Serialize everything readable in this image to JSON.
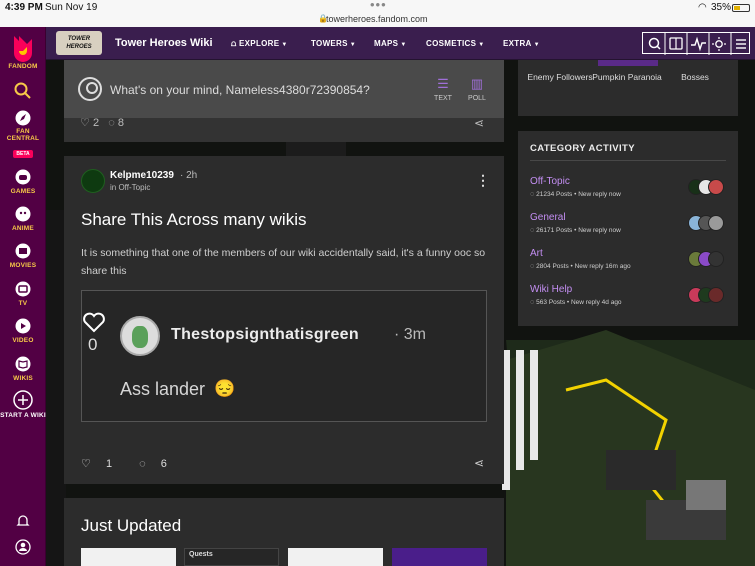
{
  "status_bar": {
    "time": "4:39 PM",
    "date": "Sun Nov 19",
    "url": "towerheroes.fandom.com",
    "battery": "35%"
  },
  "rail": {
    "items": [
      {
        "label": "FANDOM",
        "icon": "fandom-logo-icon"
      },
      {
        "label": "",
        "icon": "search-icon"
      },
      {
        "label": "FAN CENTRAL",
        "icon": "rocket-icon",
        "badge": "BETA"
      },
      {
        "label": "GAMES",
        "icon": "controller-icon"
      },
      {
        "label": "ANIME",
        "icon": "anime-icon"
      },
      {
        "label": "MOVIES",
        "icon": "movies-icon"
      },
      {
        "label": "TV",
        "icon": "tv-icon"
      },
      {
        "label": "VIDEO",
        "icon": "video-icon"
      },
      {
        "label": "WIKIS",
        "icon": "book-icon"
      },
      {
        "label": "START A WIKI",
        "icon": "plus-circle-icon"
      },
      {
        "label": "",
        "icon": "bell-icon"
      },
      {
        "label": "",
        "icon": "user-icon"
      }
    ]
  },
  "nav": {
    "logo_text": "TOWER HEROES",
    "wiki_title": "Tower Heroes Wiki",
    "items": [
      "EXPLORE",
      "TOWERS",
      "MAPS",
      "COSMETICS",
      "EXTRA"
    ],
    "icons": [
      "search-icon",
      "book-icon",
      "activity-icon",
      "theme-icon",
      "menu-icon"
    ]
  },
  "composer": {
    "prompt": "What's on your mind, Nameless4380r72390854?",
    "text_label": "TEXT",
    "poll_label": "POLL",
    "likes": "2",
    "comments": "8"
  },
  "post": {
    "author": "Kelpme10239",
    "time": "· 2h",
    "category": "in Off-Topic",
    "title": "Share This Across many wikis",
    "body": "It is something that one of the members of our wiki accidentally said, it's a funny ooc so share this",
    "embed": {
      "likes": "0",
      "user": "Thestopsignthatisgreen",
      "time": "· 3m",
      "text": "Ass lander"
    },
    "likes": "1",
    "comments": "6"
  },
  "updated": {
    "title": "Just Updated",
    "thumb_label": "Quests"
  },
  "follow": {
    "items": [
      "Enemy Followers",
      "Pumpkin Paranoia",
      "Bosses"
    ]
  },
  "activity": {
    "title": "CATEGORY ACTIVITY",
    "rows": [
      {
        "name": "Off-Topic",
        "meta": "21234 Posts • New reply now"
      },
      {
        "name": "General",
        "meta": "26171 Posts • New reply now"
      },
      {
        "name": "Art",
        "meta": "2804 Posts • New reply 16m ago"
      },
      {
        "name": "Wiki Help",
        "meta": "563 Posts • New reply 4d ago"
      }
    ]
  },
  "colors": {
    "rail_bg": "#520044",
    "nav_bg": "#3a1e4e",
    "accent_yellow": "#f7c948",
    "link_purple": "#c38ef2",
    "card_bg": "#2c2c2c"
  }
}
